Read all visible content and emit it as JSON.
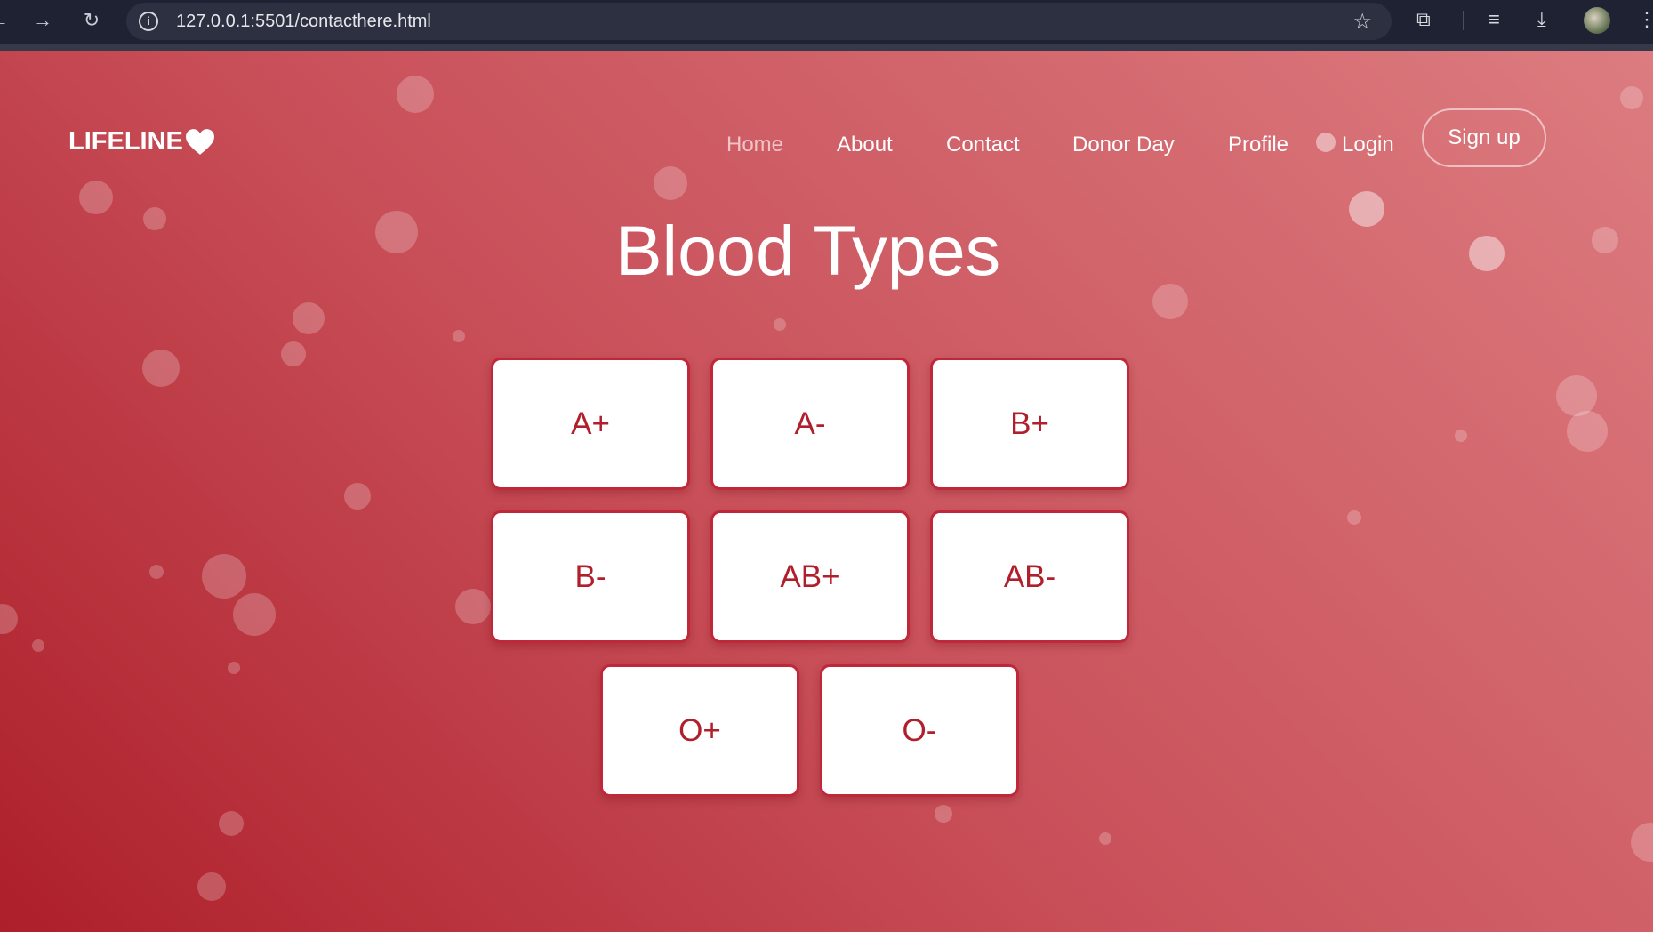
{
  "browser": {
    "url": "127.0.0.1:5501/contacthere.html"
  },
  "site": {
    "logo": "LIFELINE",
    "nav": {
      "home": "Home",
      "about": "About",
      "contact": "Contact",
      "donor_day": "Donor Day",
      "profile": "Profile",
      "login": "Login",
      "signup": "Sign up"
    },
    "title": "Blood Types",
    "blood_types": [
      "A+",
      "A-",
      "B+",
      "B-",
      "AB+",
      "AB-",
      "O+",
      "O-"
    ]
  },
  "colors": {
    "accent": "#b01f2c",
    "gradient_start": "#ad1f2a",
    "gradient_end": "#dc7c80",
    "chrome_bg": "#1f2233"
  },
  "icons": [
    "back-arrow-icon",
    "forward-arrow-icon",
    "reload-icon",
    "info-icon",
    "star-icon",
    "extensions-icon",
    "media-queue-icon",
    "download-icon",
    "menu-icon",
    "heart-icon"
  ]
}
